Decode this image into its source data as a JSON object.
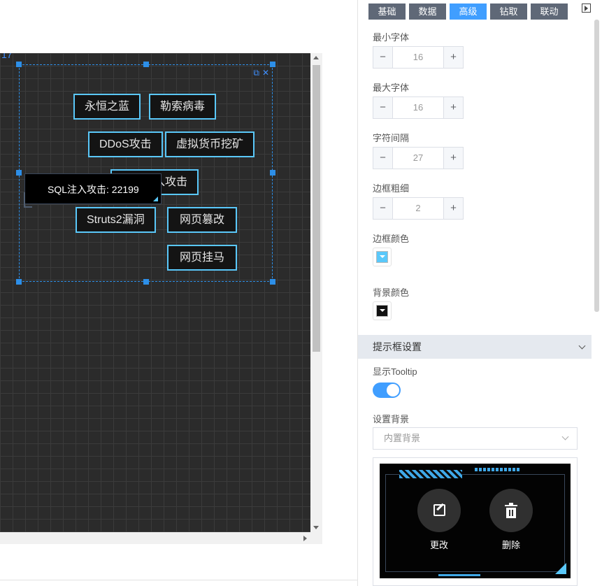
{
  "canvas": {
    "corner_text": "17",
    "tags": [
      {
        "text": "永恒之蓝"
      },
      {
        "text": "勒索病毒"
      },
      {
        "text": "DDoS攻击"
      },
      {
        "text": "虚拟货币挖矿"
      },
      {
        "text": "入攻击"
      },
      {
        "text": "Struts2漏洞"
      },
      {
        "text": "网页篡改"
      },
      {
        "text": "网页挂马"
      }
    ],
    "tooltip": "SQL注入攻击: 22199"
  },
  "panel": {
    "tabs": [
      {
        "label": "基础",
        "active": false
      },
      {
        "label": "数据",
        "active": false
      },
      {
        "label": "高级",
        "active": true
      },
      {
        "label": "钻取",
        "active": false
      },
      {
        "label": "联动",
        "active": false
      }
    ],
    "min_font": {
      "label": "最小字体",
      "value": "16"
    },
    "max_font": {
      "label": "最大字体",
      "value": "16"
    },
    "char_spacing": {
      "label": "字符间隔",
      "value": "27"
    },
    "border_width": {
      "label": "边框粗细",
      "value": "2"
    },
    "border_color": {
      "label": "边框颜色",
      "color": "#5ac8fa"
    },
    "bg_color": {
      "label": "背景颜色",
      "color": "#111111"
    },
    "tooltip_section": {
      "title": "提示框设置",
      "show_label": "显示Tooltip",
      "show_enabled": true,
      "bg_label": "设置背景",
      "bg_select": "内置背景",
      "edit_label": "更改",
      "delete_label": "删除"
    },
    "stepper": {
      "minus": "−",
      "plus": "+"
    }
  }
}
